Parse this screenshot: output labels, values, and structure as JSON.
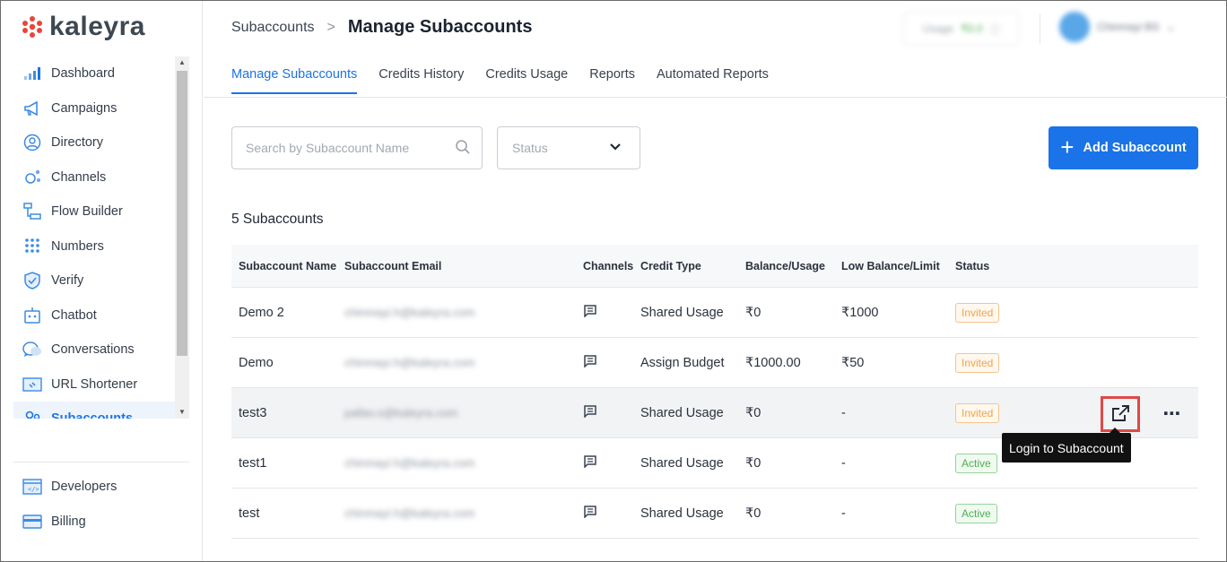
{
  "brand": {
    "name": "kaleyra",
    "accent": "#1a73e8"
  },
  "sidebar": {
    "items": [
      {
        "label": "Dashboard",
        "icon": "bar-chart-icon"
      },
      {
        "label": "Campaigns",
        "icon": "megaphone-icon"
      },
      {
        "label": "Directory",
        "icon": "contact-icon"
      },
      {
        "label": "Channels",
        "icon": "channels-icon"
      },
      {
        "label": "Flow Builder",
        "icon": "flow-icon"
      },
      {
        "label": "Numbers",
        "icon": "dial-pad-icon"
      },
      {
        "label": "Verify",
        "icon": "shield-check-icon"
      },
      {
        "label": "Chatbot",
        "icon": "bot-icon"
      },
      {
        "label": "Conversations",
        "icon": "chat-bubbles-icon"
      },
      {
        "label": "URL Shortener",
        "icon": "link-icon"
      },
      {
        "label": "Subaccounts",
        "icon": "users-icon",
        "active": true
      }
    ],
    "bottom_items": [
      {
        "label": "Developers",
        "icon": "code-window-icon"
      },
      {
        "label": "Billing",
        "icon": "credit-card-icon"
      }
    ]
  },
  "header": {
    "breadcrumb_parent": "Subaccounts",
    "breadcrumb_sep": ">",
    "title": "Manage Subaccounts",
    "balance_label": "Usage",
    "balance_value": "₹0.0",
    "user_name": "Chinmayi BS"
  },
  "tabs": [
    {
      "label": "Manage Subaccounts",
      "active": true
    },
    {
      "label": "Credits History"
    },
    {
      "label": "Credits Usage"
    },
    {
      "label": "Reports"
    },
    {
      "label": "Automated Reports"
    }
  ],
  "filters": {
    "search_placeholder": "Search by Subaccount Name",
    "status_placeholder": "Status"
  },
  "add_button_label": "Add Subaccount",
  "count_label": "5 Subaccounts",
  "table": {
    "columns": [
      "Subaccount Name",
      "Subaccount Email",
      "Channels",
      "Credit Type",
      "Balance/Usage",
      "Low Balance/Limit",
      "Status"
    ],
    "rows": [
      {
        "name": "Demo 2",
        "email": "chinmayi.h@kaleyra.com",
        "credit_type": "Shared Usage",
        "balance": "₹0",
        "limit": "₹1000",
        "status": "Invited"
      },
      {
        "name": "Demo",
        "email": "chinmayi.h@kaleyra.com",
        "credit_type": "Assign Budget",
        "balance": "₹1000.00",
        "limit": "₹50",
        "status": "Invited"
      },
      {
        "name": "test3",
        "email": "pallav.s@kaleyra.com",
        "credit_type": "Shared Usage",
        "balance": "₹0",
        "limit": "-",
        "status": "Invited"
      },
      {
        "name": "test1",
        "email": "chinmayi.h@kaleyra.com",
        "credit_type": "Shared Usage",
        "balance": "₹0",
        "limit": "-",
        "status": "Active"
      },
      {
        "name": "test",
        "email": "chinmayi.h@kaleyra.com",
        "credit_type": "Shared Usage",
        "balance": "₹0",
        "limit": "-",
        "status": "Active"
      }
    ]
  },
  "tooltip": "Login to Subaccount",
  "colors": {
    "invited": "#f0a44a",
    "active": "#4caf50",
    "highlight": "#e04848"
  }
}
